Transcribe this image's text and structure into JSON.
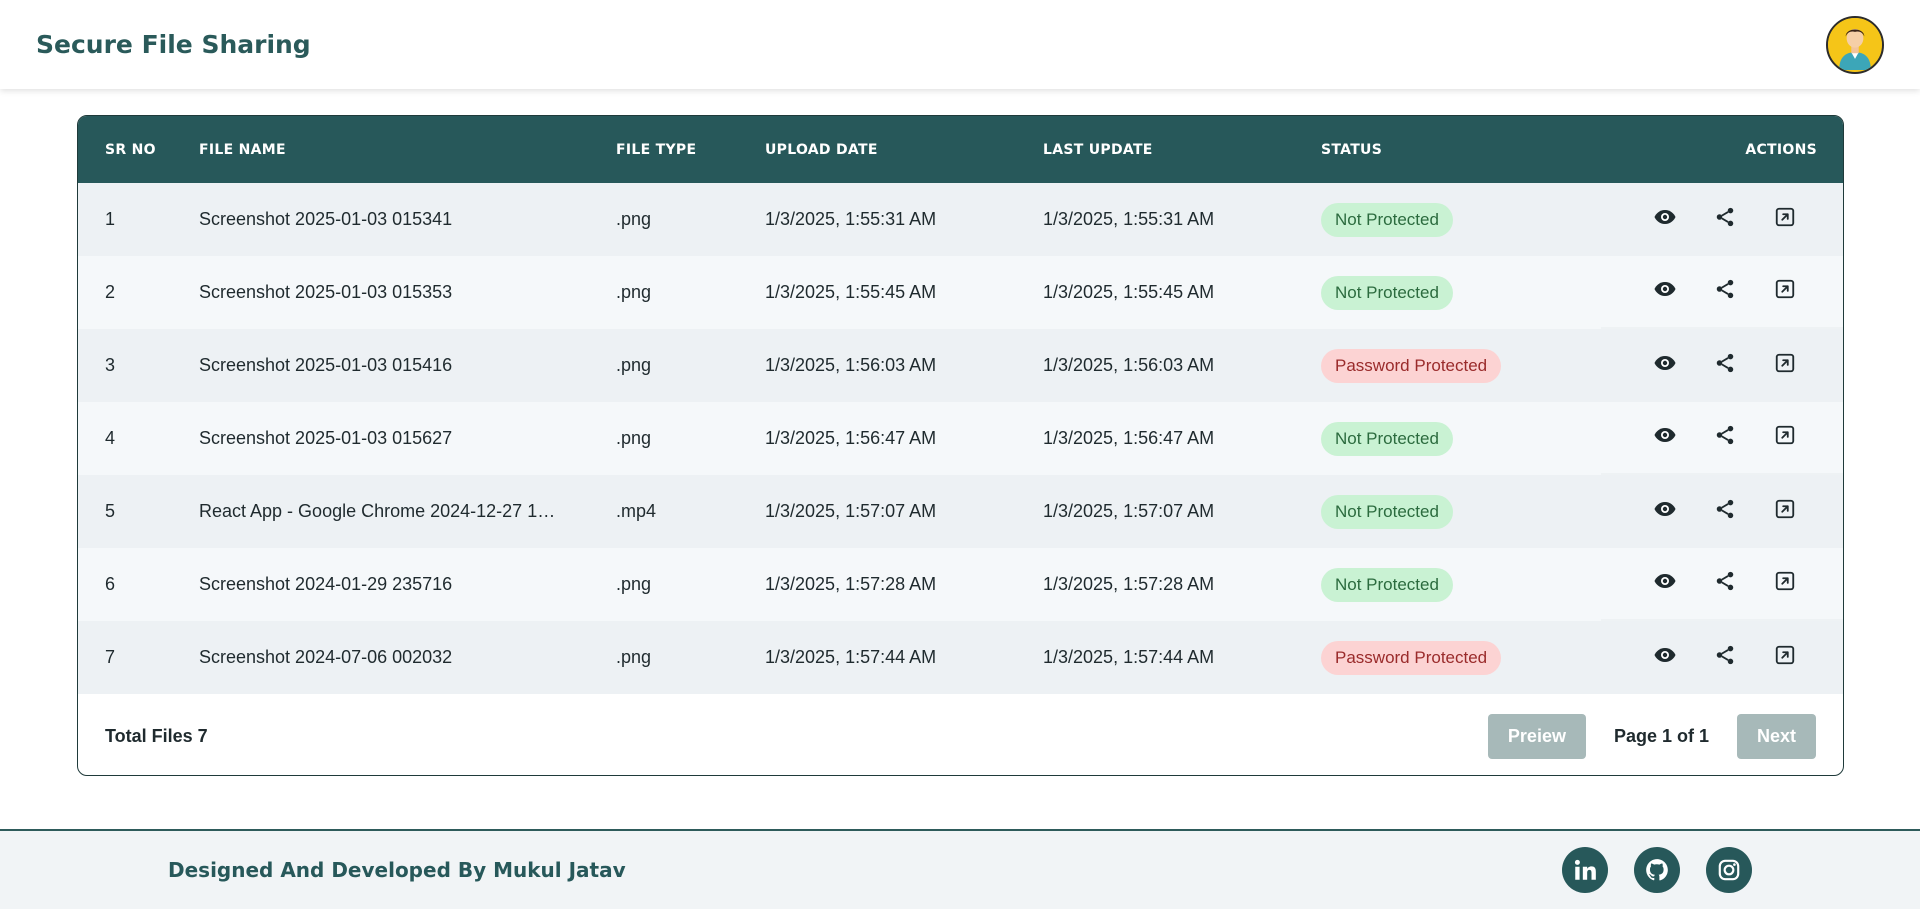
{
  "app": {
    "title": "Secure File Sharing"
  },
  "table": {
    "headers": {
      "sr": "SR NO",
      "name": "FILE NAME",
      "type": "FILE TYPE",
      "upload": "UPLOAD DATE",
      "last": "LAST UPDATE",
      "status": "STATUS",
      "actions": "ACTIONS"
    },
    "rows": [
      {
        "sr": "1",
        "name": "Screenshot 2025-01-03 015341",
        "type": ".png",
        "upload": "1/3/2025, 1:55:31 AM",
        "last": "1/3/2025, 1:55:31 AM",
        "status": "Not Protected"
      },
      {
        "sr": "2",
        "name": "Screenshot 2025-01-03 015353",
        "type": ".png",
        "upload": "1/3/2025, 1:55:45 AM",
        "last": "1/3/2025, 1:55:45 AM",
        "status": "Not Protected"
      },
      {
        "sr": "3",
        "name": "Screenshot 2025-01-03 015416",
        "type": ".png",
        "upload": "1/3/2025, 1:56:03 AM",
        "last": "1/3/2025, 1:56:03 AM",
        "status": "Password Protected"
      },
      {
        "sr": "4",
        "name": "Screenshot 2025-01-03 015627",
        "type": ".png",
        "upload": "1/3/2025, 1:56:47 AM",
        "last": "1/3/2025, 1:56:47 AM",
        "status": "Not Protected"
      },
      {
        "sr": "5",
        "name": "React App - Google Chrome 2024-12-27 1…",
        "type": ".mp4",
        "upload": "1/3/2025, 1:57:07 AM",
        "last": "1/3/2025, 1:57:07 AM",
        "status": "Not Protected"
      },
      {
        "sr": "6",
        "name": "Screenshot 2024-01-29 235716",
        "type": ".png",
        "upload": "1/3/2025, 1:57:28 AM",
        "last": "1/3/2025, 1:57:28 AM",
        "status": "Not Protected"
      },
      {
        "sr": "7",
        "name": "Screenshot 2024-07-06 002032",
        "type": ".png",
        "upload": "1/3/2025, 1:57:44 AM",
        "last": "1/3/2025, 1:57:44 AM",
        "status": "Password Protected"
      }
    ],
    "row_icons": [
      "eye-icon",
      "share-icon",
      "open-external-icon"
    ]
  },
  "pagination": {
    "total_label": "Total Files 7",
    "prev_label": "Preiew",
    "page_info": "Page 1 of 1",
    "next_label": "Next"
  },
  "footer": {
    "credit": "Designed And Developed By Mukul Jatav",
    "socials": [
      "linkedin-icon",
      "github-icon",
      "instagram-icon"
    ]
  },
  "colors": {
    "brand": "#27585a",
    "not_protected_bg": "#c9f2d3",
    "password_protected_bg": "#fcd3d3"
  }
}
